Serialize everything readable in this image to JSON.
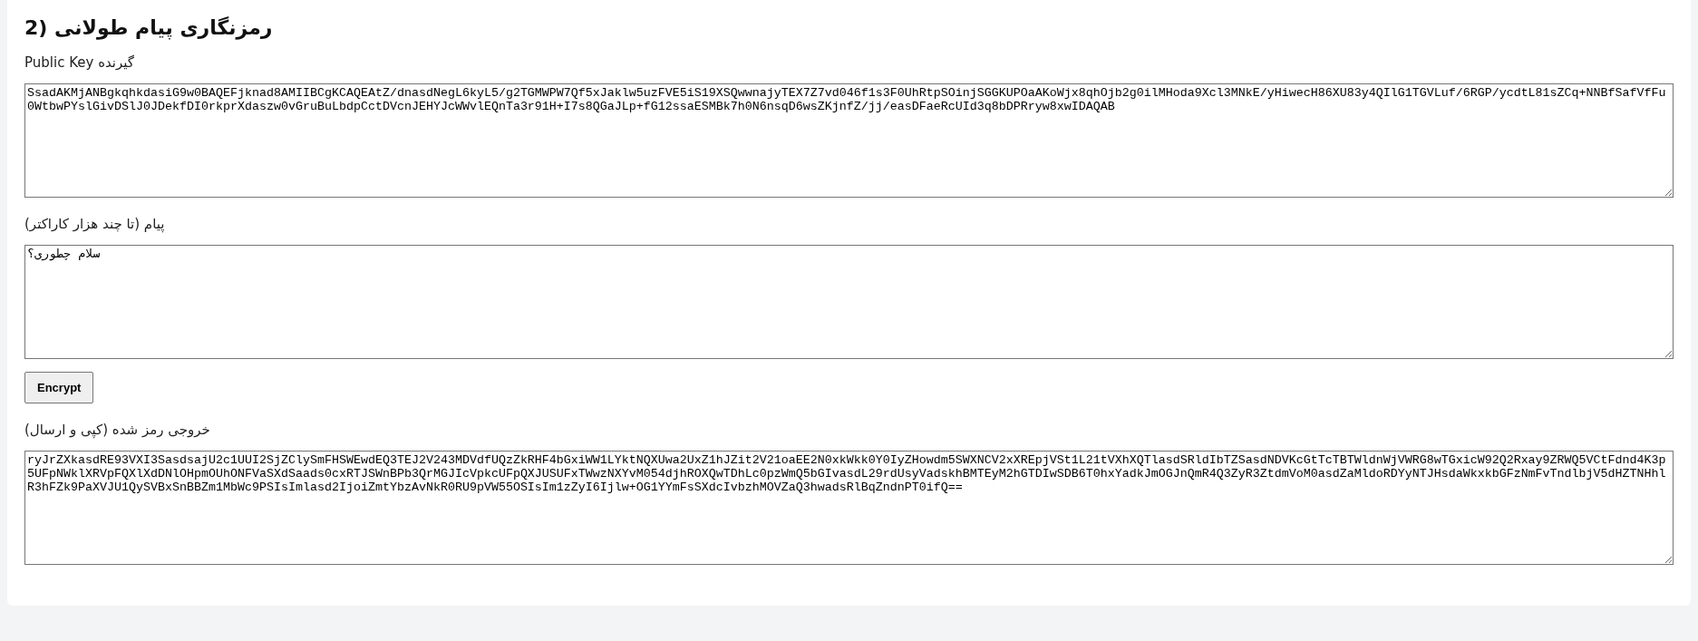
{
  "heading": "رمزنگاری پیام طولانی (2",
  "fields": [
    {
      "kind": "textarea",
      "label": "Public Key گیرنده",
      "value": "SsadAKMjANBgkqhkdasiG9w0BAQEFjknad8AMIIBCgKCAQEAtZ/dnasdNegL6kyL5/g2TGMWPW7Qf5xJaklw5uzFVE5iS19XSQwwnajyTEX7Z7vd046f1s3F0UhRtpSOinjSGGKUPOaAKoWjx8qhOjb2g0ilMHoda9Xcl3MNkE/yHiwecH86XU83y4QIlG1TGVLuf/6RGP/ycdtL81sZCq+NNBfSafVfFu0WtbwPYslGivDSlJ0JDekfDI0rkprXdaszw0vGruBuLbdpCctDVcnJEHYJcWWvlEQnTa3r91H+I7s8QGaJLp+fG12ssaESMBk7h0N6nsqD6wsZKjnfZ/jj/easDFaeRcUId3q8bDPRryw8xwIDAQAB"
    },
    {
      "kind": "textarea",
      "label": "پیام (تا چند هزار کاراکتر)",
      "value": "سلام چطوری؟"
    },
    {
      "kind": "button",
      "label": "Encrypt"
    },
    {
      "kind": "textarea",
      "label": "خروجی رمز شده (کپی و ارسال)",
      "value": "ryJrZXkasdRE93VXI3SasdsajU2c1UUI2SjZClySmFHSWEwdEQ3TEJ2V243MDVdfUQzZkRHF4bGxiWW1LYktNQXUwa2UxZ1hJZit2V21oaEE2N0xkWkk0Y0IyZHowdm5SWXNCV2xXREpjVSt1L21tVXhXQTlasdSRldIbTZSasdNDVKcGtTcTBTWldnWjVWRG8wTGxicW92Q2Rxay9ZRWQ5VCtFdnd4K3p5UFpNWklXRVpFQXlXdDNlOHpmOUhONFVaSXdSaads0cxRTJSWnBPb3QrMGJIcVpkcUFpQXJUSUFxTWwzNXYvM054djhROXQwTDhLc0pzWmQ5bGIvasdL29rdUsyVadskhBMTEyM2hGTDIwSDB6T0hxYadkJmOGJnQmR4Q3ZyR3ZtdmVoM0asdZaMldoRDYyNTJHsdaWkxkbGFzNmFvTndlbjV5dHZTNHhlR3hFZk9PaXVJU1QySVBxSnBBZm1MbWc9PSIsImlasd2IjoiZmtYbzAvNkR0RU9pVW55OSIsIm1zZyI6Ijlw+OG1YYmFsSXdcIvbzhMOVZaQ3hwadsRlBqZndnPT0ifQ=="
    }
  ]
}
